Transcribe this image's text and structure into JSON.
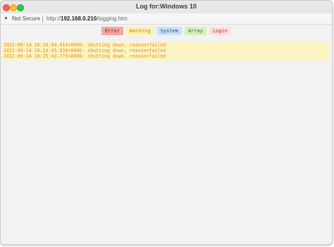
{
  "window": {
    "title": "Log for:Windows 10"
  },
  "urlbar": {
    "security_icon": "warning-triangle-icon",
    "security_label": "Not Secure",
    "url_scheme": "http://",
    "url_host": "192.168.0.210",
    "url_path": "/logging.htm"
  },
  "filters": [
    {
      "label": "Error",
      "bg": "#f4a5a5",
      "fg": "#7a2424"
    },
    {
      "label": "Warning",
      "bg": "#fcf1b5",
      "fg": "#c7841b"
    },
    {
      "label": "System",
      "bg": "#c7e3fb",
      "fg": "#1f4f7e"
    },
    {
      "label": "Array",
      "bg": "#d4f0bf",
      "fg": "#3b6b1c"
    },
    {
      "label": "Login",
      "bg": "#fde0dc",
      "fg": "#a03b2f"
    }
  ],
  "log": {
    "lines": [
      "2022-09-14 10:24:04.414+0000: shutting down, reason=failed",
      "2022-09-14 10:24:45.839+0000: shutting down, reason=failed",
      "2022-09-14 10:25:43.775+0000: shutting down, reason=failed"
    ]
  }
}
